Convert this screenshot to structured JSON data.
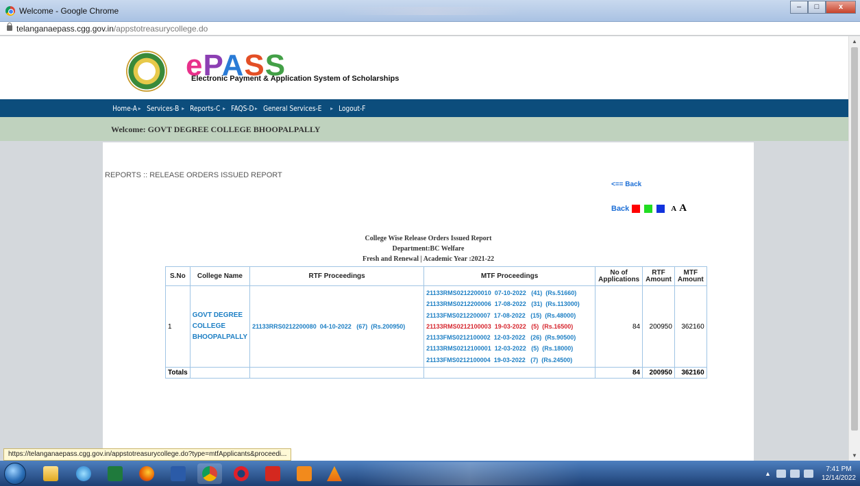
{
  "window": {
    "title": "Welcome - Google Chrome",
    "controls": {
      "minimize": "–",
      "maximize": "□",
      "close": "x"
    }
  },
  "address": {
    "host": "telanganaepass.cgg.gov.in",
    "path": "/appstotreasurycollege.do"
  },
  "header": {
    "logo_parts": {
      "e": "e",
      "p": "P",
      "a": "A",
      "s1": "S",
      "s2": "S"
    },
    "subtitle": "Electronic Payment & Application System of Scholarships"
  },
  "nav": {
    "items": [
      "Home-A",
      "Services-B",
      "Reports-C",
      "FAQS-D",
      "General Services-E",
      "Logout-F"
    ]
  },
  "welcome": "Welcome: GOVT DEGREE COLLEGE BHOOPALPALLY",
  "page": {
    "breadcrumb": "REPORTS :: RELEASE ORDERS ISSUED REPORT",
    "back_link": "<== Back",
    "back_label": "Back",
    "font_small": "A",
    "font_large": "A",
    "theme_colors": [
      "#ff0000",
      "#22dd22",
      "#1133dd"
    ],
    "report_title": "College Wise Release Orders Issued Report",
    "department": "Department:BC Welfare",
    "year_line": "Fresh and Renewal | Academic Year :2021-22"
  },
  "table": {
    "headers": {
      "sno": "S.No",
      "college": "College Name",
      "rtf": "RTF Proceedings",
      "mtf": "MTF Proceedings",
      "apps_1": "No of",
      "apps_2": "Applications",
      "rtf_amt_1": "RTF",
      "rtf_amt_2": "Amount",
      "mtf_amt_1": "MTF",
      "mtf_amt_2": "Amount"
    },
    "row": {
      "sno": "1",
      "college_1": "GOVT DEGREE",
      "college_2": "COLLEGE",
      "college_3": "BHOOPALPALLY",
      "rtf": "21133RRS0212200080  04-10-2022   (67)  (Rs.200950)",
      "mtf": [
        "21133RMS0212200010  07-10-2022   (41)  (Rs.51660)",
        "21133RMS0212200006  17-08-2022   (31)  (Rs.113000)",
        "21133FMS0212200007  17-08-2022   (15)  (Rs.48000)",
        "21133RMS0212100003  19-03-2022   (5)  (Rs.16500)",
        "21133FMS0212100002  12-03-2022   (26)  (Rs.90500)",
        "21133RMS0212100001  12-03-2022   (5)  (Rs.18000)",
        "21133FMS0212100004  19-03-2022   (7)  (Rs.24500)"
      ],
      "applications": "84",
      "rtf_amount": "200950",
      "mtf_amount": "362160"
    },
    "totals": {
      "label": "Totals",
      "applications": "84",
      "rtf_amount": "200950",
      "mtf_amount": "362160"
    }
  },
  "statusbar": "https://telanganaepass.cgg.gov.in/appstotreasurycollege.do?type=mtfApplicants&proceedi...",
  "taskbar": {
    "time": "7:41 PM",
    "date": "12/14/2022",
    "apps": [
      "ie-icon",
      "explorer-icon",
      "edge-icon",
      "excel-icon",
      "firefox-icon",
      "word-icon",
      "chrome-icon",
      "opera-icon",
      "acrobat-icon",
      "media-icon",
      "vlc-icon"
    ]
  }
}
